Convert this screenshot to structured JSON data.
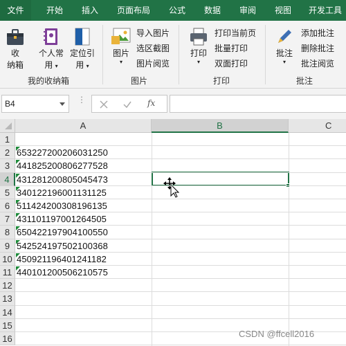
{
  "tabs": [
    "文件",
    "开始",
    "插入",
    "页面布局",
    "公式",
    "数据",
    "审阅",
    "视图",
    "开发工具"
  ],
  "ribbon": {
    "groups": {
      "favorites": "我的收纳箱",
      "picture": "图片",
      "print": "打印",
      "comment": "批注"
    },
    "btn_storage_l1": "收",
    "btn_storage_l2": "纳箱",
    "btn_personal_l1": "个人常",
    "btn_personal_l2": "用",
    "btn_locate_l1": "定位引",
    "btn_locate_l2": "用",
    "btn_picture": "图片",
    "import_picture": "导入图片",
    "region_capture": "选区截图",
    "picture_viewer": "图片阅览",
    "btn_print": "打印",
    "print_current_page": "打印当前页",
    "batch_print": "批量打印",
    "duplex_print": "双面打印",
    "btn_comment": "批注",
    "add_comment": "添加批注",
    "delete_comment": "删除批注",
    "comment_viewer": "批注阅览"
  },
  "formula_bar": {
    "name_box": "B4",
    "fx_label": "fx",
    "formula": ""
  },
  "sheet": {
    "columns": [
      "A",
      "B",
      "C"
    ],
    "rows": [
      "1",
      "2",
      "3",
      "4",
      "5",
      "6",
      "7",
      "8",
      "9",
      "10",
      "11",
      "12",
      "13",
      "14",
      "15",
      "16"
    ],
    "cells_a": [
      "",
      "653227200206031250",
      "441825200806277528",
      "431281200805045473",
      "340122196001131125",
      "511424200308196135",
      "431101197001264505",
      "650422197904100550",
      "542524197502100368",
      "450921196401241182",
      "440101200506210575"
    ],
    "active_cell": "B4"
  },
  "watermark": "CSDN @ffcell2016",
  "colors": {
    "accent": "#217346",
    "tab_active": "#1e6b40",
    "error_marker": "#1e8a3a"
  }
}
